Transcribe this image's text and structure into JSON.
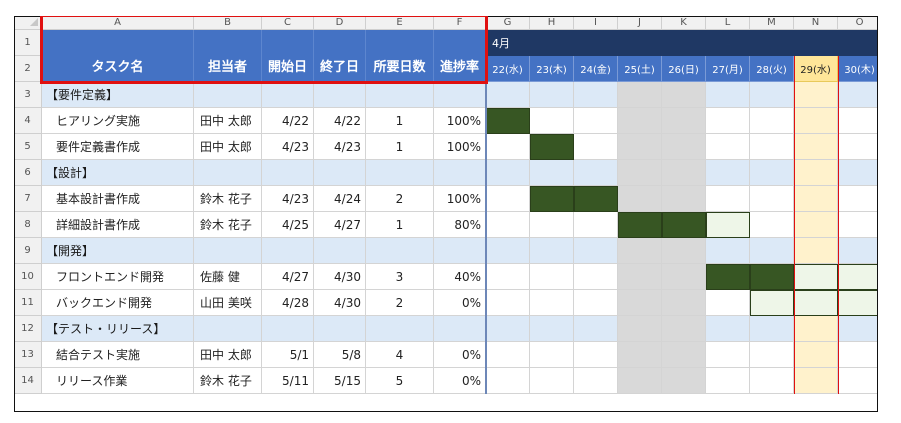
{
  "columns": [
    "A",
    "B",
    "C",
    "D",
    "E",
    "F",
    "G",
    "H",
    "I",
    "J",
    "K",
    "L",
    "M",
    "N",
    "O"
  ],
  "rows": [
    "1",
    "2",
    "3",
    "4",
    "5",
    "6",
    "7",
    "8",
    "9",
    "10",
    "11",
    "12",
    "13",
    "14"
  ],
  "header": {
    "task": "タスク名",
    "owner": "担当者",
    "start": "開始日",
    "end": "終了日",
    "duration": "所要日数",
    "progress": "進捗率"
  },
  "month_label": "4月",
  "dates": [
    "22(水)",
    "23(木)",
    "24(金)",
    "25(土)",
    "26(日)",
    "27(月)",
    "28(火)",
    "29(水)",
    "30(木)"
  ],
  "weekend_indexes": [
    3,
    4
  ],
  "today_index": 7,
  "colors": {
    "header_blue": "#4472c4",
    "month_navy": "#1f3864",
    "section_blue": "#dce9f7",
    "bar_green": "#375623",
    "planned_green": "#eef6e8",
    "weekend_gray": "#d9d9d9",
    "today_yellow": "#fff2cc",
    "highlight_red": "#e01010"
  },
  "table_rows": [
    {
      "type": "section",
      "label": "【要件定義】"
    },
    {
      "type": "task",
      "name": "ヒアリング実施",
      "owner": "田中 太郎",
      "start": "4/22",
      "end": "4/22",
      "days": "1",
      "progress": "100%",
      "gantt_start_index": 0,
      "gantt_length": 1,
      "done_length": 1
    },
    {
      "type": "task",
      "name": "要件定義書作成",
      "owner": "田中 太郎",
      "start": "4/23",
      "end": "4/23",
      "days": "1",
      "progress": "100%",
      "gantt_start_index": 1,
      "gantt_length": 1,
      "done_length": 1
    },
    {
      "type": "section",
      "label": "【設計】"
    },
    {
      "type": "task",
      "name": "基本設計書作成",
      "owner": "鈴木 花子",
      "start": "4/23",
      "end": "4/24",
      "days": "2",
      "progress": "100%",
      "gantt_start_index": 1,
      "gantt_length": 2,
      "done_length": 2
    },
    {
      "type": "task",
      "name": "詳細設計書作成",
      "owner": "鈴木 花子",
      "start": "4/25",
      "end": "4/27",
      "days": "1",
      "progress": "80%",
      "gantt_start_index": 3,
      "gantt_length": 3,
      "done_length": 2
    },
    {
      "type": "section",
      "label": "【開発】"
    },
    {
      "type": "task",
      "name": "フロントエンド開発",
      "owner": "佐藤 健",
      "start": "4/27",
      "end": "4/30",
      "days": "3",
      "progress": "40%",
      "gantt_start_index": 5,
      "gantt_length": 4,
      "done_length": 2
    },
    {
      "type": "task",
      "name": "バックエンド開発",
      "owner": "山田 美咲",
      "start": "4/28",
      "end": "4/30",
      "days": "2",
      "progress": "0%",
      "gantt_start_index": 6,
      "gantt_length": 3,
      "done_length": 0
    },
    {
      "type": "section",
      "label": "【テスト・リリース】"
    },
    {
      "type": "task",
      "name": "結合テスト実施",
      "owner": "田中 太郎",
      "start": "5/1",
      "end": "5/8",
      "days": "4",
      "progress": "0%",
      "gantt_start_index": 9,
      "gantt_length": 0,
      "done_length": 0
    },
    {
      "type": "task",
      "name": "リリース作業",
      "owner": "鈴木 花子",
      "start": "5/11",
      "end": "5/15",
      "days": "5",
      "progress": "0%",
      "gantt_start_index": 9,
      "gantt_length": 0,
      "done_length": 0
    }
  ]
}
